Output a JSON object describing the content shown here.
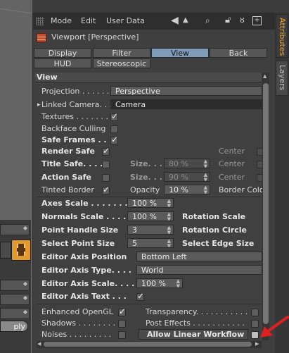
{
  "menubar": {
    "items": [
      "Mode",
      "Edit",
      "User Data"
    ]
  },
  "panel": {
    "title": "Viewport [Perspective]"
  },
  "tabs": [
    {
      "label": "Display",
      "active": false
    },
    {
      "label": "Filter",
      "active": false
    },
    {
      "label": "View",
      "active": true
    },
    {
      "label": "Back",
      "active": false
    },
    {
      "label": "HUD",
      "active": false
    },
    {
      "label": "Stereoscopic",
      "active": false
    }
  ],
  "section": "View",
  "fields": {
    "projection_label": "Projection . . . . . .",
    "projection_value": "Perspective",
    "linked_camera_label": "Linked Camera. . .",
    "linked_camera_value": "Camera",
    "textures_label": "Textures . . . . . . .",
    "backface_label": "Backface Culling",
    "safe_frames_label": "Safe Frames . .",
    "render_safe_label": "Render Safe",
    "title_safe_label": "Title Safe. . . .",
    "action_safe_label": "Action Safe",
    "tinted_border_label": "Tinted Border",
    "size_label": "Size. . . .",
    "size_title_value": "80 %",
    "size_action_value": "90 %",
    "opacity_label": "Opacity",
    "opacity_value": "10 %",
    "center_label": "Center",
    "border_color_label": "Border Colo",
    "axes_scale_label": "Axes Scale . . . . . . .",
    "axes_scale_value": "100 %",
    "normals_scale_label": "Normals Scale . . . .",
    "normals_scale_value": "100 %",
    "rotation_scale_label": "Rotation Scale",
    "point_handle_label": "Point Handle Size",
    "point_handle_value": "3",
    "rotation_circle_label": "Rotation Circle",
    "select_point_label": "Select Point Size",
    "select_point_value": "5",
    "select_edge_label": "Select Edge Size",
    "editor_axis_position_label": "Editor Axis Position",
    "editor_axis_position_value": "Bottom Left",
    "editor_axis_type_label": "Editor Axis Type. . . .",
    "editor_axis_type_value": "World",
    "editor_axis_scale_label": "Editor Axis Scale. . . .",
    "editor_axis_scale_value": "100 %",
    "editor_axis_text_label": "Editor Axis Text . . .",
    "enhanced_opengl_label": "Enhanced OpenGL",
    "shadows_label": "Shadows . . . . . . . .",
    "noises_label": "Noises . . . . . . . . .",
    "transparency_label": "Transparency. . . . . . . . . . .",
    "post_effects_label": "Post Effects . . . . . . . . . . .",
    "allow_linear_label": "Allow Linear Workflow"
  },
  "side_tabs": [
    "Attributes",
    "Layers"
  ],
  "left": {
    "input_value": "ply"
  },
  "colors": {
    "accent_tab": "#7f9bb8",
    "annotation_arrow": "#e02020",
    "side_tab_active": "#e8a035"
  }
}
